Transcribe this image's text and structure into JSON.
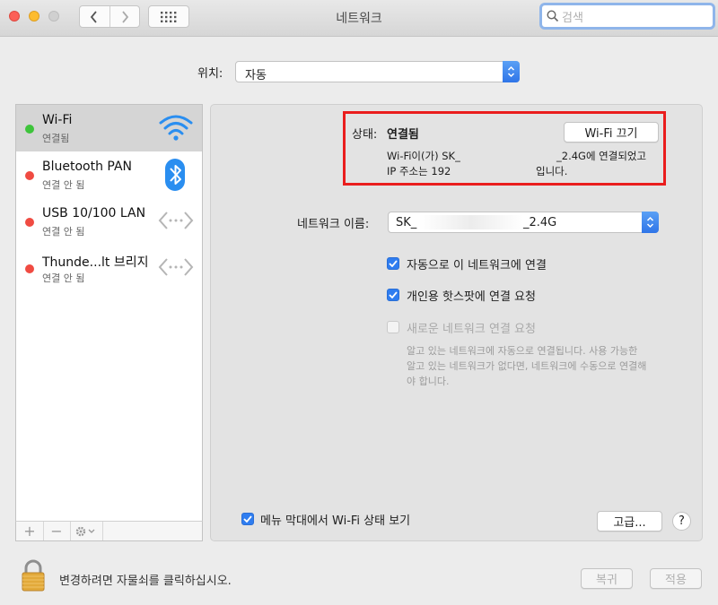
{
  "window": {
    "title": "네트워크"
  },
  "toolbar": {
    "search_placeholder": "검색"
  },
  "location": {
    "label": "위치:",
    "value": "자동"
  },
  "services": [
    {
      "name": "Wi-Fi",
      "status": "연결됨",
      "status_color": "#3ec43b",
      "icon": "wifi-icon"
    },
    {
      "name": "Bluetooth PAN",
      "status": "연결 안 됨",
      "status_color": "#f04b42",
      "icon": "bluetooth-icon"
    },
    {
      "name": "USB 10/100 LAN",
      "status": "연결 안 됨",
      "status_color": "#f04b42",
      "icon": "ethernet-icon"
    },
    {
      "name": "Thunde...lt 브리지",
      "status": "연결 안 됨",
      "status_color": "#f04b42",
      "icon": "ethernet-icon"
    }
  ],
  "sidebar_controls": {
    "add": "+",
    "remove": "−"
  },
  "status": {
    "label": "상태:",
    "value": "연결됨",
    "turn_off_button": "Wi-Fi 끄기",
    "line1_a": "Wi-Fi이(가) SK_",
    "line1_b": "_2.4G에 연결되었고",
    "line2_a": "IP 주소는 192",
    "line2_b": "입니다."
  },
  "network_name": {
    "label": "네트워크 이름:",
    "value_a": "SK_",
    "value_b": "_2.4G"
  },
  "options": [
    {
      "label": "자동으로 이 네트워크에 연결",
      "checked": true,
      "enabled": true
    },
    {
      "label": "개인용 핫스팟에 연결 요청",
      "checked": true,
      "enabled": true
    },
    {
      "label": "새로운 네트워크 연결 요청",
      "checked": false,
      "enabled": false
    }
  ],
  "options_help": [
    "알고 있는 네트워크에 자동으로 연결됩니다. 사용 가능한",
    "알고 있는 네트워크가 없다면, 네트워크에 수동으로 연결해",
    "야 합니다."
  ],
  "menubar_option": {
    "label": "메뉴 막대에서 Wi-Fi 상태 보기",
    "checked": true
  },
  "advanced_button": "고급...",
  "help_button": "?",
  "footer": {
    "lock_text": "변경하려면 자물쇠를 클릭하십시오.",
    "revert": "복귀",
    "apply": "적용"
  },
  "colors": {
    "accent": "#2f7df0",
    "highlight_box": "#ea1d1d"
  }
}
